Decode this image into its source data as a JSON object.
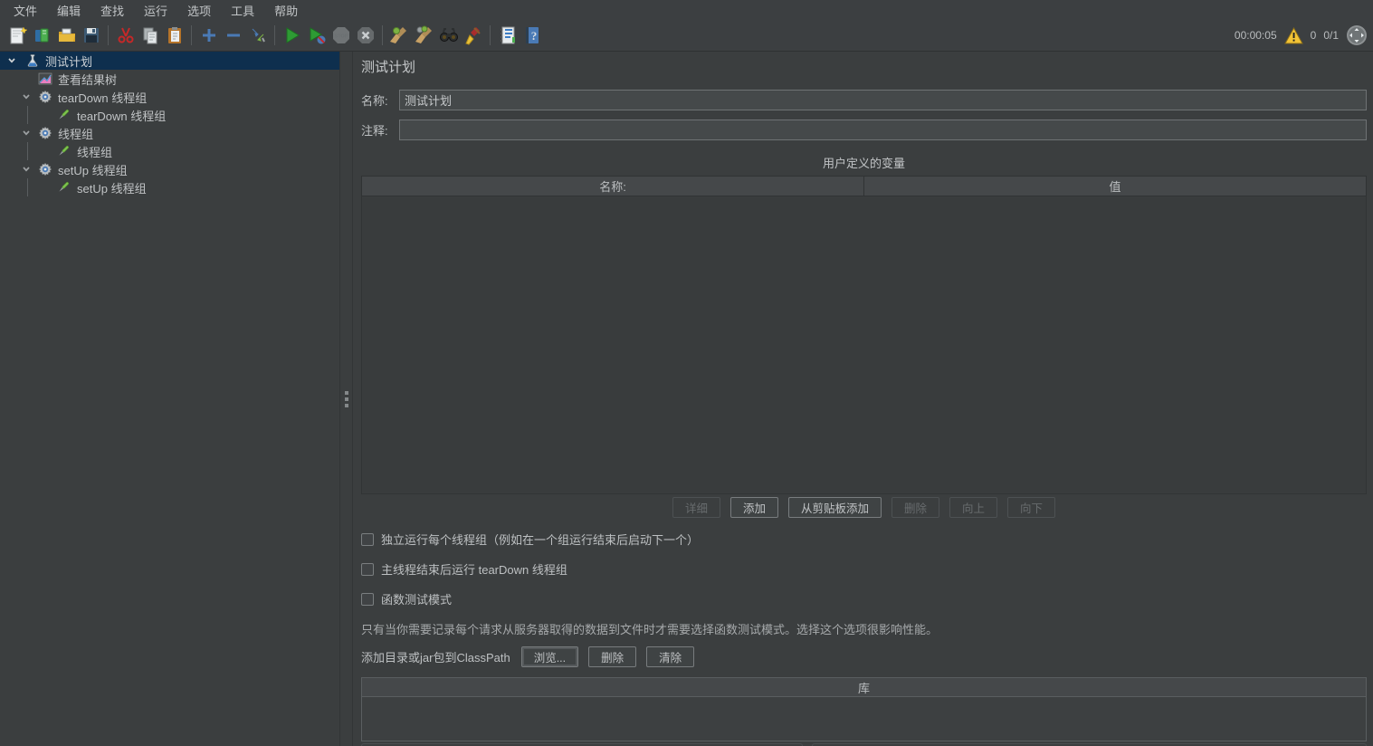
{
  "menu": {
    "items": [
      "文件",
      "编辑",
      "查找",
      "运行",
      "选项",
      "工具",
      "帮助"
    ]
  },
  "toolbar": {
    "icons": [
      "new-file",
      "open-template",
      "open-file",
      "save",
      "cut",
      "copy",
      "paste",
      "expand-all",
      "collapse-all",
      "toggle",
      "start",
      "start-no-timers",
      "stop",
      "shutdown",
      "clear",
      "clear-all",
      "search",
      "clear-search",
      "function-helper",
      "help"
    ],
    "timer": "00:00:05",
    "warning_count": "0",
    "threads_ratio": "0/1"
  },
  "tree": {
    "items": [
      {
        "label": "测试计划",
        "icon": "test-plan-flask-icon",
        "selected": true
      },
      {
        "label": "查看结果树",
        "icon": "results-tree-chart-icon"
      },
      {
        "label": "tearDown 线程组",
        "icon": "thread-group-gear-icon"
      },
      {
        "label": "tearDown 线程组",
        "icon": "sampler-dropper-icon"
      },
      {
        "label": "线程组",
        "icon": "thread-group-gear-icon"
      },
      {
        "label": "线程组",
        "icon": "sampler-dropper-icon"
      },
      {
        "label": "setUp 线程组",
        "icon": "thread-group-gear-icon"
      },
      {
        "label": "setUp 线程组",
        "icon": "sampler-dropper-icon"
      }
    ]
  },
  "main": {
    "title": "测试计划",
    "name_label": "名称:",
    "name_value": "测试计划",
    "comment_label": "注释:",
    "comment_value": "",
    "udv": {
      "title": "用户定义的变量",
      "columns": [
        "名称:",
        "值"
      ],
      "rows": []
    },
    "udv_buttons": [
      {
        "label": "详细",
        "enabled": false
      },
      {
        "label": "添加",
        "enabled": true
      },
      {
        "label": "从剪贴板添加",
        "enabled": true
      },
      {
        "label": "删除",
        "enabled": false
      },
      {
        "label": "向上",
        "enabled": false
      },
      {
        "label": "向下",
        "enabled": false
      }
    ],
    "checkboxes": [
      {
        "label": "独立运行每个线程组（例如在一个组运行结束后启动下一个）",
        "checked": false
      },
      {
        "label": "主线程结束后运行 tearDown 线程组",
        "checked": false
      },
      {
        "label": "函数测试模式",
        "checked": false
      }
    ],
    "note": "只有当你需要记录每个请求从服务器取得的数据到文件时才需要选择函数测试模式。选择这个选项很影响性能。",
    "classpath": {
      "label": "添加目录或jar包到ClassPath",
      "buttons": [
        "浏览...",
        "删除",
        "清除"
      ]
    },
    "library": {
      "header": "库",
      "rows": []
    }
  },
  "colors": {
    "panel_bg": "#3b3e3f",
    "selection_blue": "#0e2f4e",
    "field_bg": "#45494a",
    "warning_yellow": "#f2c335",
    "start_green": "#2e9b34"
  }
}
